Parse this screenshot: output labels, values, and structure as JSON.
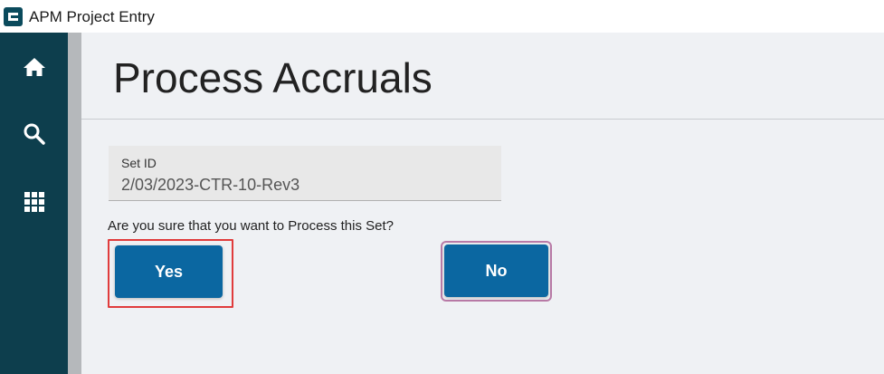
{
  "window": {
    "title": "APM Project Entry",
    "logo_icon": "app-logo-icon"
  },
  "sidebar": {
    "items": [
      {
        "icon": "home-icon"
      },
      {
        "icon": "search-icon"
      },
      {
        "icon": "apps-grid-icon"
      }
    ]
  },
  "page": {
    "title": "Process Accruals"
  },
  "set_field": {
    "label": "Set ID",
    "value": "2/03/2023-CTR-10-Rev3"
  },
  "dialog": {
    "prompt": "Are you sure that you want to Process this Set?",
    "yes_label": "Yes",
    "no_label": "No"
  },
  "colors": {
    "sidebar": "#0d3e4d",
    "button": "#0b67a1",
    "highlight": "#e03c3c",
    "focus_ring": "#b97ba7"
  }
}
